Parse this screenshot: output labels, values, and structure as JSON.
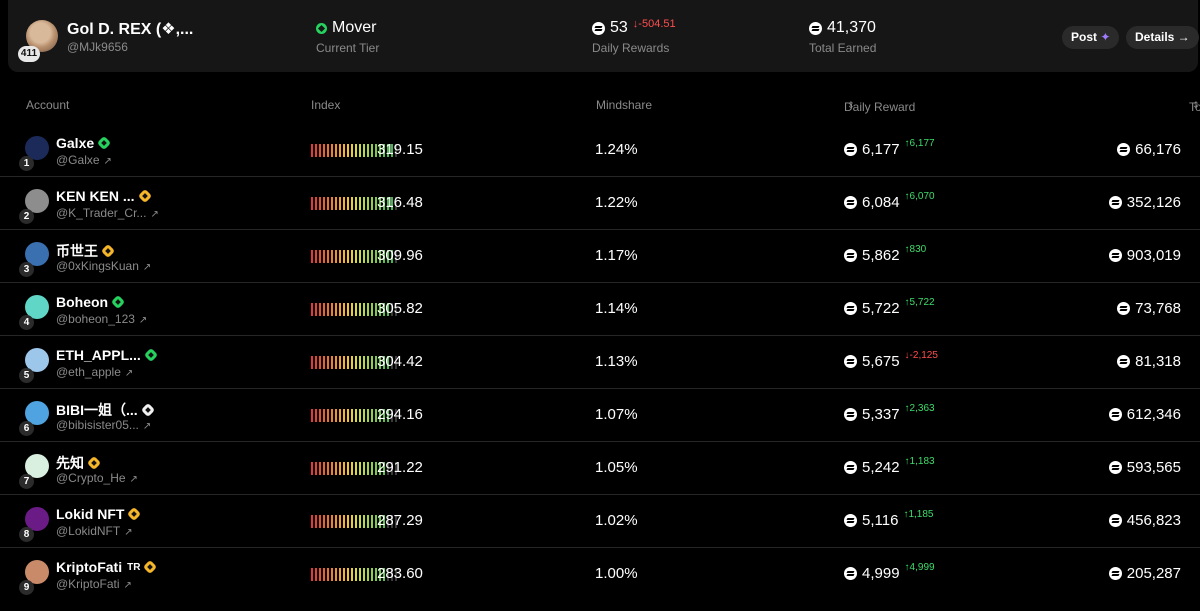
{
  "profile": {
    "name": "Gol D. REX (❖,...",
    "handle": "@MJk9656",
    "badge": "411",
    "tier": {
      "value": "Mover",
      "label": "Current Tier"
    },
    "daily_rewards": {
      "value": "53",
      "change": "↓-504.51",
      "label": "Daily Rewards"
    },
    "total_earned": {
      "value": "41,370",
      "label": "Total Earned"
    },
    "post_label": "Post",
    "post_icon": "✦",
    "details_label": "Details →"
  },
  "columns": {
    "account": "Account",
    "index": "Index",
    "mindshare": "Mindshare",
    "daily_reward": "Daily Reward",
    "total_reward": "Total Reward"
  },
  "icons": {
    "sort": "sort-icon",
    "external": "external-link-icon",
    "coin": "coin-icon"
  },
  "colors": {
    "positive": "#3ddc6b",
    "negative": "#ff4d4f",
    "verified_green": "#27d35f",
    "verified_gold": "#f5b62a"
  },
  "rows": [
    {
      "rank": "1",
      "name": "Galxe",
      "handle": "@Galxe",
      "badge": "green",
      "index": "319.15",
      "mindshare": "1.24%",
      "daily": "6,177",
      "change": "↑6,177",
      "trend": "pos",
      "total": "66,176",
      "avatar": "#1c2a5a"
    },
    {
      "rank": "2",
      "name": "KEN KEN ...",
      "handle": "@K_Trader_Cr...",
      "badge": "gold",
      "index": "316.48",
      "mindshare": "1.22%",
      "daily": "6,084",
      "change": "↑6,070",
      "trend": "pos",
      "total": "352,126",
      "avatar": "#8d8d8d"
    },
    {
      "rank": "3",
      "name": "币世王",
      "handle": "@0xKingsKuan",
      "badge": "gold",
      "index": "309.96",
      "mindshare": "1.17%",
      "daily": "5,862",
      "change": "↑830",
      "trend": "pos",
      "total": "903,019",
      "avatar": "#3a6fb0"
    },
    {
      "rank": "4",
      "name": "Boheon",
      "handle": "@boheon_123",
      "badge": "green",
      "index": "305.82",
      "mindshare": "1.14%",
      "daily": "5,722",
      "change": "↑5,722",
      "trend": "pos",
      "total": "73,768",
      "avatar": "#5fd6c6"
    },
    {
      "rank": "5",
      "name": "ETH_APPL...",
      "handle": "@eth_apple",
      "badge": "green",
      "index": "304.42",
      "mindshare": "1.13%",
      "daily": "5,675",
      "change": "↓-2,125",
      "trend": "neg",
      "total": "81,318",
      "avatar": "#9cc7ea"
    },
    {
      "rank": "6",
      "name": "BIBI一姐（...",
      "handle": "@bibisister05...",
      "badge": "white",
      "index": "294.16",
      "mindshare": "1.07%",
      "daily": "5,337",
      "change": "↑2,363",
      "trend": "pos",
      "total": "612,346",
      "avatar": "#4fa3e0"
    },
    {
      "rank": "7",
      "name": "先知",
      "handle": "@Crypto_He",
      "badge": "gold",
      "index": "291.22",
      "mindshare": "1.05%",
      "daily": "5,242",
      "change": "↑1,183",
      "trend": "pos",
      "total": "593,565",
      "avatar": "#d9efe0"
    },
    {
      "rank": "8",
      "name": "Lokid NFT",
      "handle": "@LokidNFT",
      "badge": "gold",
      "index": "287.29",
      "mindshare": "1.02%",
      "daily": "5,116",
      "change": "↑1,185",
      "trend": "pos",
      "total": "456,823",
      "avatar": "#6b1b86"
    },
    {
      "rank": "9",
      "name": "KriptoFati",
      "name_suffix": "TR",
      "handle": "@KriptoFati",
      "badge": "gold",
      "index": "283.60",
      "mindshare": "1.00%",
      "daily": "4,999",
      "change": "↑4,999",
      "trend": "pos",
      "total": "205,287",
      "avatar": "#c98a6a"
    }
  ]
}
